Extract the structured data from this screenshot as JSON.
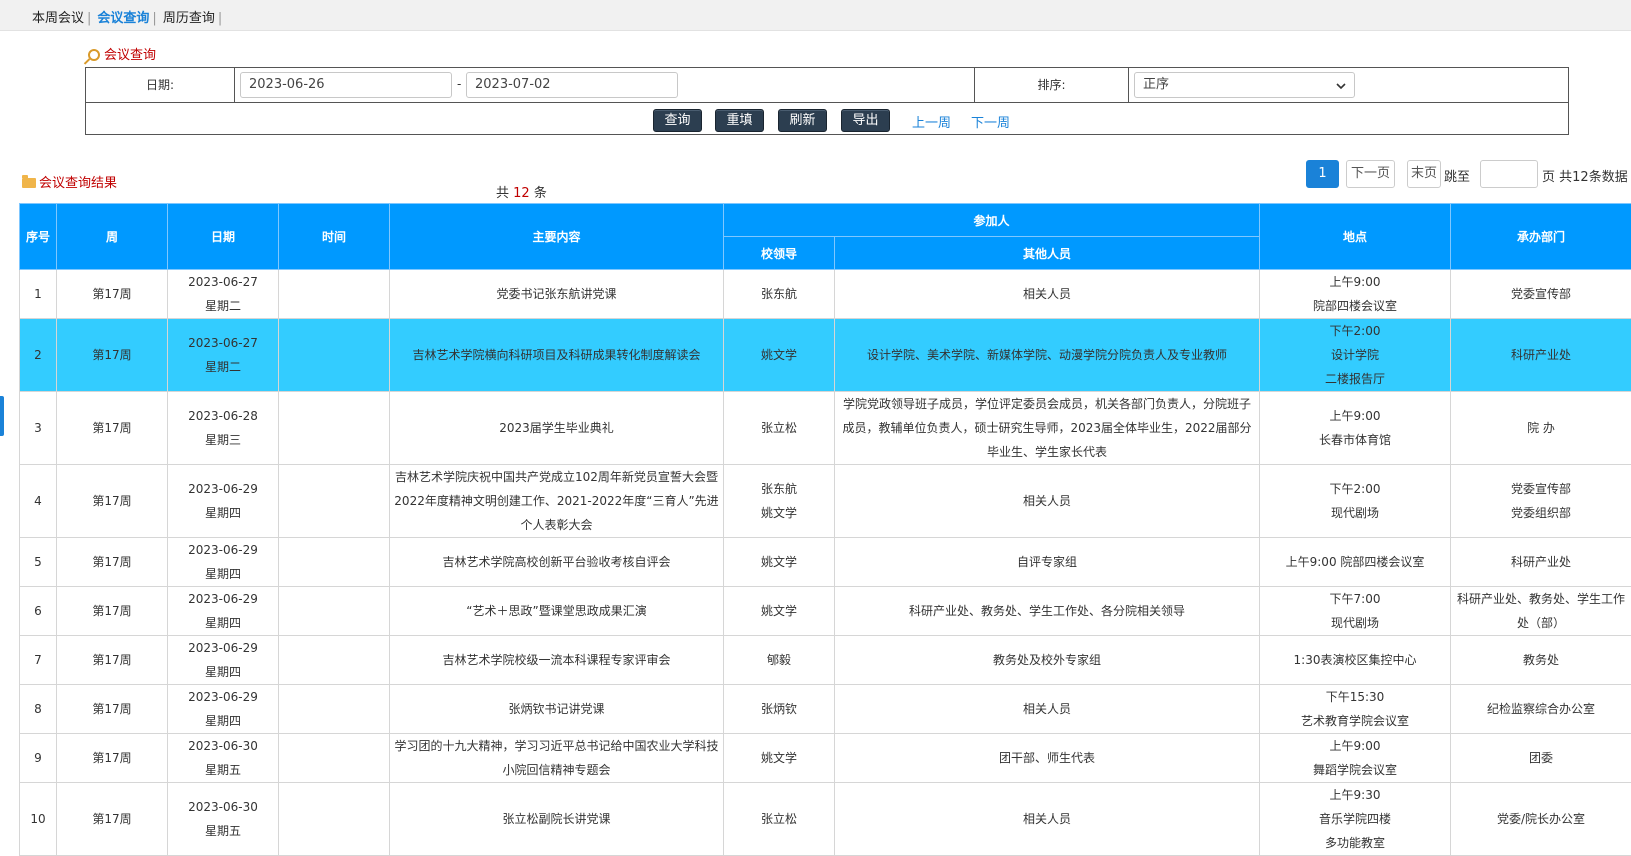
{
  "nav": {
    "items": [
      "本周会议",
      "会议查询",
      "周历查询"
    ],
    "separator": "|"
  },
  "query": {
    "title": "会议查询",
    "date_label": "日期:",
    "date_from": "2023-06-26",
    "dash": "-",
    "date_to": "2023-07-02",
    "sort_label": "排序:",
    "sort_value": "正序",
    "buttons": {
      "search": "查询",
      "reset": "重填",
      "refresh": "刷新",
      "export": "导出"
    },
    "prev_week": "上一周",
    "next_week": "下一周"
  },
  "results": {
    "title": "会议查询结果",
    "count_prefix": "共",
    "count": "12",
    "count_suffix": "条"
  },
  "pager": {
    "current": "1",
    "next": "下一页",
    "last": "末页",
    "jump_label": "跳至",
    "jump_value": "",
    "page_suffix": "页",
    "total_text": "共12条数据"
  },
  "table": {
    "headers": {
      "index": "序号",
      "week": "周",
      "date": "日期",
      "time": "时间",
      "content": "主要内容",
      "participants": "参加人",
      "leaders": "校领导",
      "others": "其他人员",
      "location": "地点",
      "department": "承办部门"
    },
    "rows": [
      {
        "idx": "1",
        "week": "第17周",
        "date": [
          "2023-06-27",
          "星期二"
        ],
        "time": "",
        "content": "党委书记张东航讲党课",
        "leader": [
          "张东航"
        ],
        "others": "相关人员",
        "location": [
          "上午9:00",
          "院部四楼会议室"
        ],
        "dept": [
          "党委宣传部"
        ]
      },
      {
        "idx": "2",
        "week": "第17周",
        "date": [
          "2023-06-27",
          "星期二"
        ],
        "time": "",
        "content": "吉林艺术学院横向科研项目及科研成果转化制度解读会",
        "leader": [
          "姚文学"
        ],
        "others": "设计学院、美术学院、新媒体学院、动漫学院分院负责人及专业教师",
        "location": [
          "下午2:00",
          "设计学院",
          "二楼报告厅"
        ],
        "dept": [
          "科研产业处"
        ]
      },
      {
        "idx": "3",
        "week": "第17周",
        "date": [
          "2023-06-28",
          "星期三"
        ],
        "time": "",
        "content": "2023届学生毕业典礼",
        "leader": [
          "张立松"
        ],
        "others": "学院党政领导班子成员，学位评定委员会成员，机关各部门负责人，分院班子成员，教辅单位负责人，硕士研究生导师，2023届全体毕业生，2022届部分毕业生、学生家长代表",
        "location": [
          "上午9:00",
          "长春市体育馆"
        ],
        "dept": [
          "院 办"
        ]
      },
      {
        "idx": "4",
        "week": "第17周",
        "date": [
          "2023-06-29",
          "星期四"
        ],
        "time": "",
        "content": "吉林艺术学院庆祝中国共产党成立102周年新党员宣誓大会暨2022年度精神文明创建工作、2021-2022年度“三育人”先进个人表彰大会",
        "leader": [
          "张东航",
          "姚文学"
        ],
        "others": "相关人员",
        "location": [
          "下午2:00",
          "现代剧场"
        ],
        "dept": [
          "党委宣传部",
          "党委组织部"
        ]
      },
      {
        "idx": "5",
        "week": "第17周",
        "date": [
          "2023-06-29",
          "星期四"
        ],
        "time": "",
        "content": "吉林艺术学院高校创新平台验收考核自评会",
        "leader": [
          "姚文学"
        ],
        "others": "自评专家组",
        "location": [
          "上午9:00 院部四楼会议室"
        ],
        "dept": [
          "科研产业处"
        ]
      },
      {
        "idx": "6",
        "week": "第17周",
        "date": [
          "2023-06-29",
          "星期四"
        ],
        "time": "",
        "content": "“艺术＋思政”暨课堂思政成果汇演",
        "leader": [
          "姚文学"
        ],
        "others": "科研产业处、教务处、学生工作处、各分院相关领导",
        "location": [
          "下午7:00",
          "现代剧场"
        ],
        "dept": [
          "科研产业处、教务处、学生工作处（部）"
        ]
      },
      {
        "idx": "7",
        "week": "第17周",
        "date": [
          "2023-06-29",
          "星期四"
        ],
        "time": "",
        "content": "吉林艺术学院校级一流本科课程专家评审会",
        "leader": [
          "郇毅"
        ],
        "others": "教务处及校外专家组",
        "location": [
          "1:30表演校区集控中心"
        ],
        "dept": [
          "教务处"
        ]
      },
      {
        "idx": "8",
        "week": "第17周",
        "date": [
          "2023-06-29",
          "星期四"
        ],
        "time": "",
        "content": "张炳钦书记讲党课",
        "leader": [
          "张炳钦"
        ],
        "others": "相关人员",
        "location": [
          "下午15:30",
          "艺术教育学院会议室"
        ],
        "dept": [
          "纪检监察综合办公室"
        ]
      },
      {
        "idx": "9",
        "week": "第17周",
        "date": [
          "2023-06-30",
          "星期五"
        ],
        "time": "",
        "content": "学习团的十九大精神，学习习近平总书记给中国农业大学科技小院回信精神专题会",
        "leader": [
          "姚文学"
        ],
        "others": "团干部、师生代表",
        "location": [
          "上午9:00",
          "舞蹈学院会议室"
        ],
        "dept": [
          "团委"
        ]
      },
      {
        "idx": "10",
        "week": "第17周",
        "date": [
          "2023-06-30",
          "星期五"
        ],
        "time": "",
        "content": "张立松副院长讲党课",
        "leader": [
          "张立松"
        ],
        "others": "相关人员",
        "location": [
          "上午9:30",
          "音乐学院四楼",
          "多功能教室"
        ],
        "dept": [
          "党委/院长办公室"
        ]
      }
    ]
  }
}
